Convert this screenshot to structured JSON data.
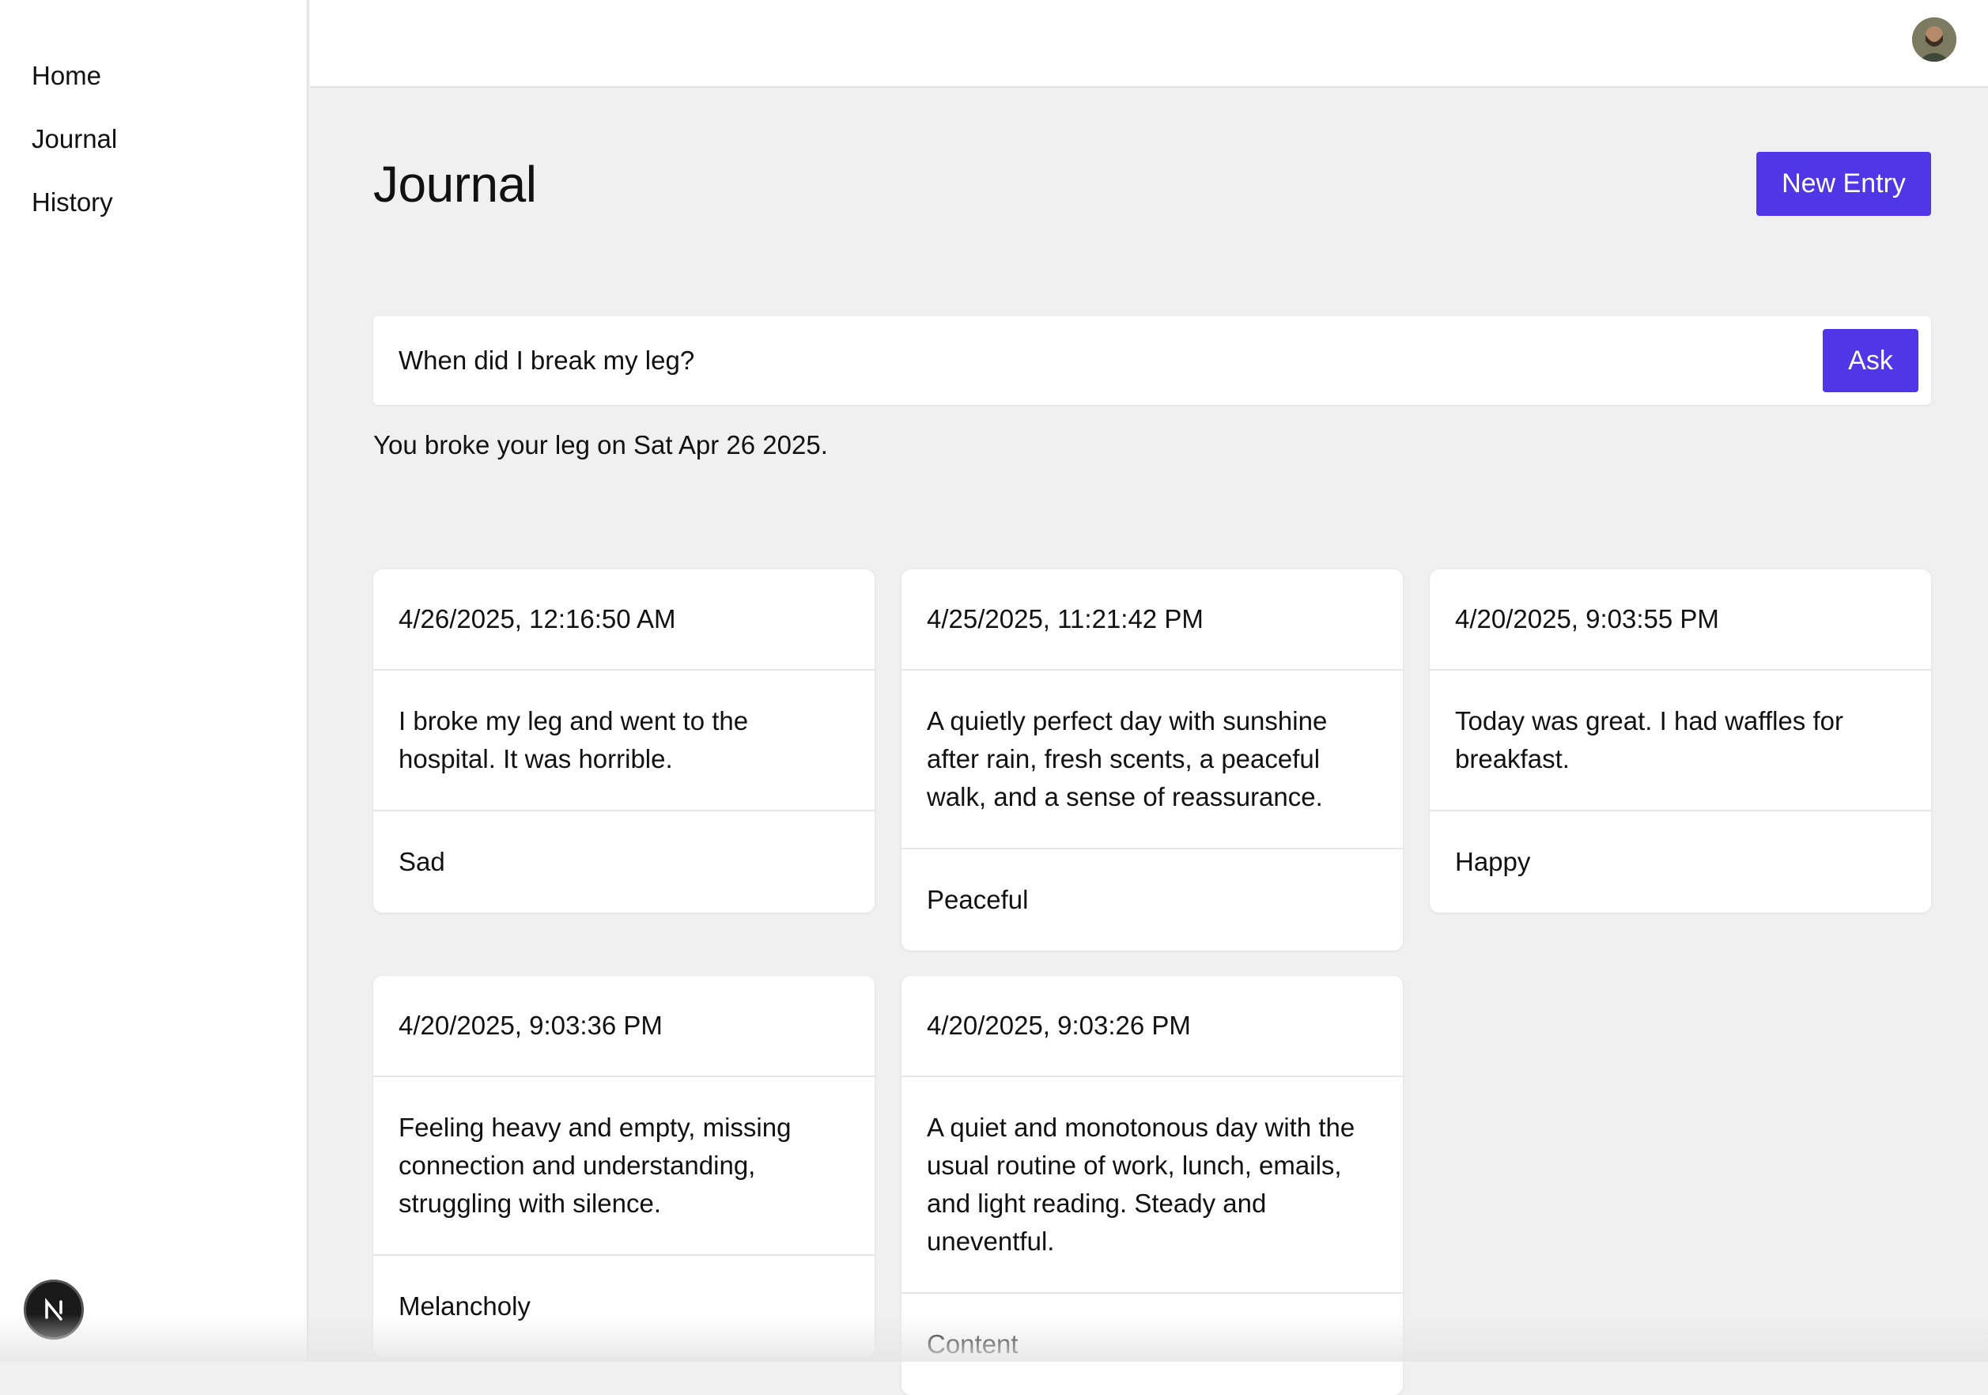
{
  "sidebar": {
    "items": [
      {
        "label": "Home"
      },
      {
        "label": "Journal"
      },
      {
        "label": "History"
      }
    ],
    "badge_icon": "nextjs-logo-icon"
  },
  "header": {
    "avatar_icon": "user-avatar-icon"
  },
  "main": {
    "title": "Journal",
    "new_entry_label": "New Entry",
    "ask": {
      "value": "When did I break my leg?",
      "button_label": "Ask"
    },
    "answer": "You broke your leg on Sat Apr 26 2025.",
    "entries": [
      {
        "date": "4/26/2025, 12:16:50 AM",
        "summary": "I broke my leg and went to the hospital. It was horrible.",
        "mood": "Sad"
      },
      {
        "date": "4/25/2025, 11:21:42 PM",
        "summary": "A quietly perfect day with sunshine after rain, fresh scents, a peaceful walk, and a sense of reassurance.",
        "mood": "Peaceful"
      },
      {
        "date": "4/20/2025, 9:03:55 PM",
        "summary": "Today was great. I had waffles for breakfast.",
        "mood": "Happy"
      },
      {
        "date": "4/20/2025, 9:03:36 PM",
        "summary": "Feeling heavy and empty, missing connection and understanding, struggling with silence.",
        "mood": "Melancholy"
      },
      {
        "date": "4/20/2025, 9:03:26 PM",
        "summary": "A quiet and monotonous day with the usual routine of work, lunch, emails, and light reading. Steady and uneventful.",
        "mood": "Content"
      }
    ]
  },
  "colors": {
    "accent": "#4f36e6",
    "background": "#f0f0f0",
    "surface": "#ffffff"
  }
}
